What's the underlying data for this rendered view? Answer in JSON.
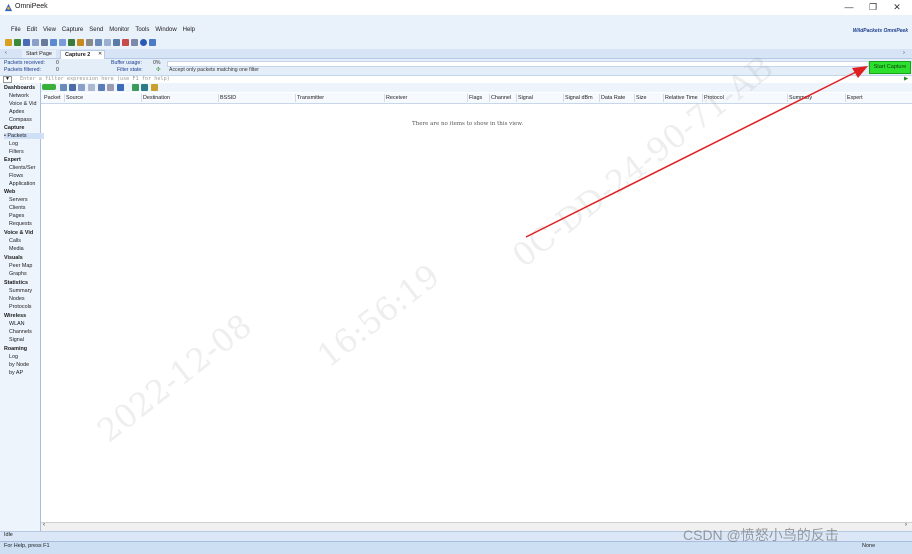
{
  "window": {
    "title": "OmniPeek",
    "minimize": "—",
    "restore": "❐",
    "close": "✕"
  },
  "menu": [
    "File",
    "Edit",
    "View",
    "Capture",
    "Send",
    "Monitor",
    "Tools",
    "Window",
    "Help"
  ],
  "brand": "WildPackets OmniPeek",
  "tabs": {
    "start_page": "Start Page",
    "capture": "Capture 2",
    "close": "✕"
  },
  "info": {
    "packets_received_label": "Packets received:",
    "packets_received": "0",
    "packets_filtered_label": "Packets filtered:",
    "packets_filtered": "0",
    "buffer_usage_label": "Buffer usage:",
    "buffer_usage": "0%",
    "filter_state_label": "Filter state:",
    "filter_state": "Accept only packets matching one filter",
    "start_capture": "Start Capture",
    "filter_placeholder": "Enter a filter expression here (use F1 for help)"
  },
  "sidebar": {
    "dashboards": "Dashboards",
    "network": "Network",
    "voice_video": "Voice & Vid",
    "apdex": "Apdex",
    "compass": "Compass",
    "capture": "Capture",
    "packets": "• Packets",
    "log": "Log",
    "filters": "Filters",
    "expert": "Expert",
    "clients_servers": "Clients/Ser",
    "flows": "Flows",
    "application": "Application",
    "web": "Web",
    "servers": "Servers",
    "clients": "Clients",
    "pages": "Pages",
    "requests": "Requests",
    "voice_vid": "Voice & Vid",
    "calls": "Calls",
    "media": "Media",
    "visuals": "Visuals",
    "peer_map": "Peer Map",
    "graphs": "Graphs",
    "statistics": "Statistics",
    "summary": "Summary",
    "nodes": "Nodes",
    "protocols": "Protocols",
    "wireless": "Wireless",
    "wlan": "WLAN",
    "channels": "Channels",
    "signal": "Signal",
    "roaming": "Roaming",
    "roam_log": "Log",
    "by_node": "by Node",
    "by_ap": "by AP"
  },
  "columns": {
    "packet": "Packet",
    "source": "Source",
    "destination": "Destination",
    "bssid": "BSSID",
    "transmitter": "Transmitter",
    "receiver": "Receiver",
    "flags": "Flags",
    "channel": "Channel",
    "signal": "Signal",
    "signal_dbm": "Signal dBm",
    "data_rate": "Data Rate",
    "size": "Size",
    "relative_time": "Relative Time",
    "protocol": "Protocol",
    "summary": "Summary",
    "expert": "Expert"
  },
  "empty_message": "There are no items to show in this view.",
  "status": {
    "idle": "Idle",
    "help": "For Help, press F1",
    "none": "None"
  },
  "watermark": {
    "date": "2022-12-08",
    "time": "16:56:19",
    "id": "0C-DD-24-90-71-AB",
    "credit": "CSDN @愤怒小鸟的反击"
  },
  "colors": {
    "start_capture": "#2ee02e",
    "arrow": "#e02020",
    "chrome": "#e9f1fb"
  }
}
